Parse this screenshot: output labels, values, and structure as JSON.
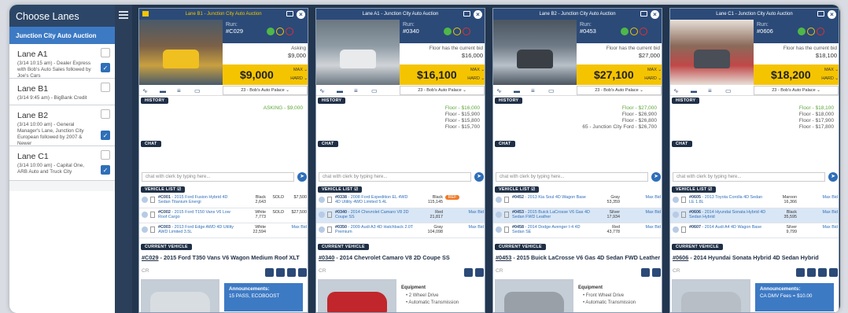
{
  "sidebar": {
    "title": "Choose Lanes",
    "auction": "Junction City Auto Auction",
    "lanes": [
      {
        "name": "Lane A1",
        "desc": "(3/14 10:15 am) - Dealer Express with Bob's Auto Sales followed by Joe's Cars",
        "checked": true
      },
      {
        "name": "Lane B1",
        "desc": "(3/14 9:45 am) - BigBank Credit",
        "checked": false
      },
      {
        "name": "Lane B2",
        "desc": "(3/14 10:00 am) - General Manager's Lane, Junction City European followed by 2007 & Newer",
        "checked": true
      },
      {
        "name": "Lane C1",
        "desc": "(3/14 10:00 am) - Capital One, ARB Auto and Truck City",
        "checked": true
      }
    ]
  },
  "common": {
    "run_label": "Run:",
    "max": "MAX",
    "hard": "HARD",
    "history_tag": "HISTORY",
    "chat_tag": "CHAT",
    "vlist_tag": "VEHICLE LIST",
    "cv_tag": "CURRENT VEHICLE",
    "chat_placeholder": "chat with clerk by typing here...",
    "cr": "CR",
    "equipment": "Equipment",
    "select": "23 - Bob's Auto Palace"
  },
  "panels": [
    {
      "title": "Lane B1 - Junction City Auto Auction",
      "run": "#C029",
      "status_line": "Asking",
      "status_value": "$9,000",
      "price": "$9,000",
      "history": [
        "ASKING - $9,000"
      ],
      "vehicles": [
        {
          "id": "#C001",
          "name": "2015 Ford Fusion Hybrid 4D Sedan Titanium Energi",
          "color": "Black",
          "miles": "2,643",
          "status": "SOLD",
          "bid": "$7,500"
        },
        {
          "id": "#C002",
          "name": "2015 Ford T150 Vans V6 Low Roof Cargo",
          "color": "White",
          "miles": "7,773",
          "status": "SOLD",
          "bid": "$27,500"
        },
        {
          "id": "#C003",
          "name": "2013 Ford Edge AWD 4D Utility AWD Limited 3.5L",
          "color": "White",
          "miles": "22,594",
          "status": "",
          "bid": "Max Bid"
        }
      ],
      "cv_id": "#C029",
      "cv_title": "2015 Ford T350 Vans V6 Wagon Medium Roof XLT",
      "ann_title": "Announcements:",
      "ann_text": "15 PASS, ECOBOOST",
      "equip": []
    },
    {
      "title": "Lane A1 - Junction City Auto Auction",
      "run": "#0340",
      "status_line": "Floor has the current bid",
      "status_value": "$16,000",
      "price": "$16,100",
      "history": [
        "Floor - $16,000",
        "Floor - $15,900",
        "Floor - $15,800",
        "Floor - $15,700"
      ],
      "vehicles": [
        {
          "id": "#0338",
          "name": "2008 Ford Expedition EL 4WD 4D Utility 4WD Limited 5.4L",
          "color": "Black",
          "miles": "115,145",
          "status": "REF",
          "bid": ""
        },
        {
          "id": "#0340",
          "name": "2014 Chevrolet Camaro V8 2D Coupe SS",
          "color": "Red",
          "miles": "21,817",
          "status": "",
          "bid": "Max Bid"
        },
        {
          "id": "#0350",
          "name": "2009 Audi A3 4D Hatchback 2.0T Premium",
          "color": "Gray",
          "miles": "104,098",
          "status": "",
          "bid": "Max Bid"
        }
      ],
      "cv_id": "#0340",
      "cv_title": "2014 Chevrolet Camaro V8 2D Coupe SS",
      "equip": [
        "2 Wheel Drive",
        "Automatic Transmission"
      ]
    },
    {
      "title": "Lane B2 - Junction City Auto Auction",
      "run": "#0453",
      "status_line": "Floor has the current bid",
      "status_value": "$27,000",
      "price": "$27,100",
      "history": [
        "Floor - $27,000",
        "Floor - $26,900",
        "Floor - $26,800",
        "65 - Junction City Ford - $26,700"
      ],
      "vehicles": [
        {
          "id": "#0452",
          "name": "2013 Kia Soul 4D Wagon Base",
          "color": "Gray",
          "miles": "53,359",
          "status": "",
          "bid": "Max Bid"
        },
        {
          "id": "#0453",
          "name": "2015 Buick LaCrosse V6 Gas 4D Sedan FWD Leather",
          "color": "Silver",
          "miles": "17,934",
          "status": "",
          "bid": "Max Bid"
        },
        {
          "id": "#0458",
          "name": "2014 Dodge Avenger I-4 4D Sedan SE",
          "color": "Red",
          "miles": "43,778",
          "status": "",
          "bid": "Max Bid"
        }
      ],
      "cv_id": "#0453",
      "cv_title": "2015 Buick LaCrosse V6 Gas 4D Sedan FWD Leather",
      "equip": [
        "Front Wheel Drive",
        "Automatic Transmission"
      ]
    },
    {
      "title": "Lane C1 - Junction City Auto Auction",
      "run": "#0606",
      "status_line": "Floor has the current bid",
      "status_value": "$18,100",
      "price": "$18,200",
      "history": [
        "Floor - $18,100",
        "Floor - $18,000",
        "Floor - $17,900",
        "Floor - $17,800"
      ],
      "vehicles": [
        {
          "id": "#0605",
          "name": "2013 Toyota Corolla 4D Sedan LE 1.8L",
          "color": "Maroon",
          "miles": "16,366",
          "status": "",
          "bid": "Max Bid"
        },
        {
          "id": "#0606",
          "name": "2014 Hyundai Sonata Hybrid 4D Sedan Hybrid",
          "color": "Black",
          "miles": "35,595",
          "status": "",
          "bid": "Max Bid"
        },
        {
          "id": "#0607",
          "name": "2014 Audi A4 4D Wagon Base",
          "color": "Silver",
          "miles": "9,799",
          "status": "",
          "bid": "Max Bid"
        }
      ],
      "cv_id": "#0606",
      "cv_title": "2014 Hyundai Sonata Hybrid 4D Sedan Hybrid",
      "ann_title": "Announcements:",
      "ann_text": "CA DMV Fees = $10.00",
      "equip": []
    }
  ]
}
